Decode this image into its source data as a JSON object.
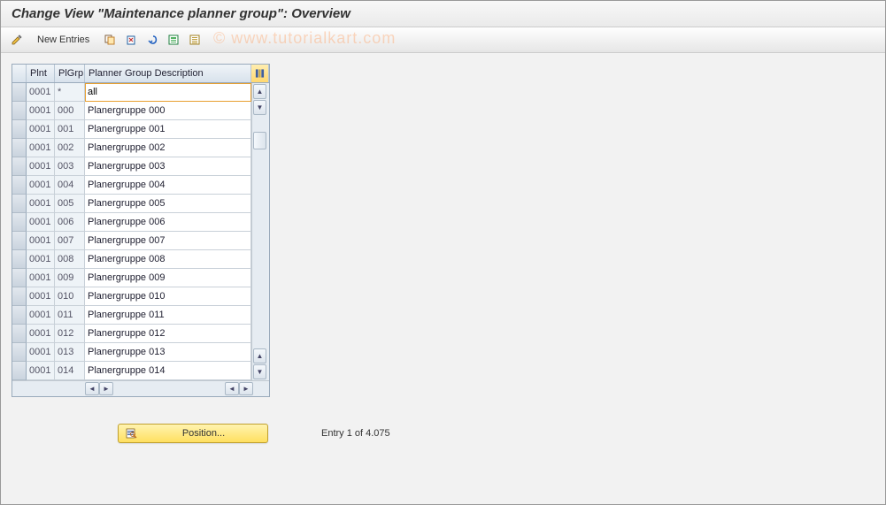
{
  "title": "Change View \"Maintenance planner group\": Overview",
  "watermark": "© www.tutorialkart.com",
  "toolbar": {
    "new_entries_label": "New Entries"
  },
  "table": {
    "columns": {
      "plnt": "Plnt",
      "plgrp": "PlGrp",
      "desc": "Planner Group Description"
    },
    "rows": [
      {
        "plnt": "0001",
        "plgrp": "*",
        "desc": "all"
      },
      {
        "plnt": "0001",
        "plgrp": "000",
        "desc": "Planergruppe 000"
      },
      {
        "plnt": "0001",
        "plgrp": "001",
        "desc": "Planergruppe 001"
      },
      {
        "plnt": "0001",
        "plgrp": "002",
        "desc": "Planergruppe 002"
      },
      {
        "plnt": "0001",
        "plgrp": "003",
        "desc": "Planergruppe 003"
      },
      {
        "plnt": "0001",
        "plgrp": "004",
        "desc": "Planergruppe 004"
      },
      {
        "plnt": "0001",
        "plgrp": "005",
        "desc": "Planergruppe 005"
      },
      {
        "plnt": "0001",
        "plgrp": "006",
        "desc": "Planergruppe 006"
      },
      {
        "plnt": "0001",
        "plgrp": "007",
        "desc": "Planergruppe 007"
      },
      {
        "plnt": "0001",
        "plgrp": "008",
        "desc": "Planergruppe 008"
      },
      {
        "plnt": "0001",
        "plgrp": "009",
        "desc": "Planergruppe 009"
      },
      {
        "plnt": "0001",
        "plgrp": "010",
        "desc": "Planergruppe 010"
      },
      {
        "plnt": "0001",
        "plgrp": "011",
        "desc": "Planergruppe 011"
      },
      {
        "plnt": "0001",
        "plgrp": "012",
        "desc": "Planergruppe 012"
      },
      {
        "plnt": "0001",
        "plgrp": "013",
        "desc": "Planergruppe 013"
      },
      {
        "plnt": "0001",
        "plgrp": "014",
        "desc": "Planergruppe 014"
      }
    ]
  },
  "position_button": "Position...",
  "entry_status": "Entry 1 of 4.075"
}
